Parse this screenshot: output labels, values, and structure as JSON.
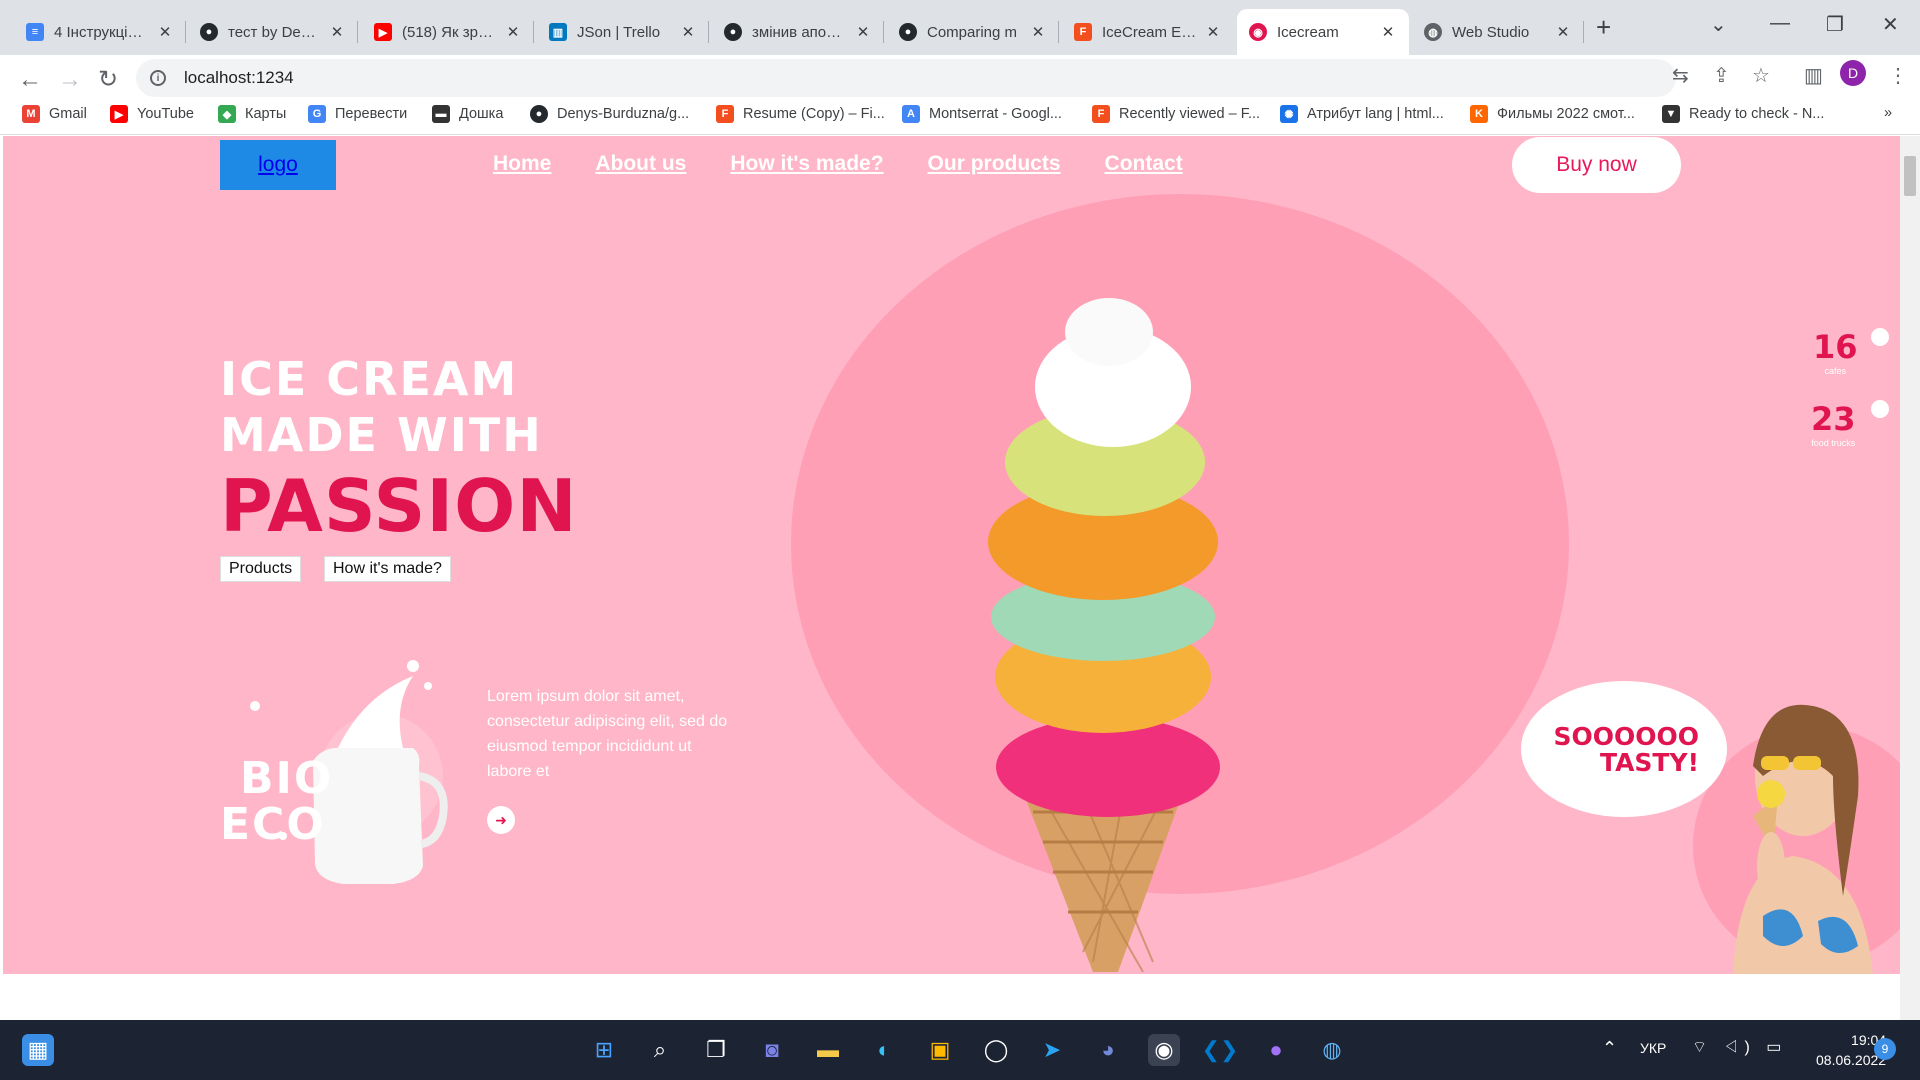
{
  "browser": {
    "tabs": [
      {
        "label": "4 Інструкція по",
        "icon": "docs-icon",
        "color": "#4285f4"
      },
      {
        "label": "тест by Denys",
        "icon": "github-icon",
        "color": "#24292e"
      },
      {
        "label": "(518) Як зробити",
        "icon": "youtube-icon",
        "color": "#ff0000"
      },
      {
        "label": "JSon | Trello",
        "icon": "trello-icon",
        "color": "#0079bf"
      },
      {
        "label": "змінив апостро",
        "icon": "github-icon",
        "color": "#24292e"
      },
      {
        "label": "Comparing m",
        "icon": "github-icon",
        "color": "#24292e"
      },
      {
        "label": "IceCream En (",
        "icon": "figma-icon",
        "color": "#f24e1e"
      },
      {
        "label": "Icecream",
        "icon": "icecream-icon",
        "color": "#e0154f"
      },
      {
        "label": "Web Studio",
        "icon": "globe-icon",
        "color": "#5f6368"
      }
    ],
    "url": "localhost:1234",
    "bookmarks": [
      {
        "label": "Gmail",
        "icon": "gmail-icon",
        "color": "#ea4335"
      },
      {
        "label": "YouTube",
        "icon": "youtube-icon",
        "color": "#ff0000"
      },
      {
        "label": "Карты",
        "icon": "maps-icon",
        "color": "#34a853"
      },
      {
        "label": "Перевести",
        "icon": "translate-icon",
        "color": "#4285f4"
      },
      {
        "label": "Дошка",
        "icon": "board-icon",
        "color": "#333333"
      },
      {
        "label": "Denys-Burduzna/g...",
        "icon": "github-icon",
        "color": "#24292e"
      },
      {
        "label": "Resume (Copy) – Fi...",
        "icon": "figma-icon",
        "color": "#f24e1e"
      },
      {
        "label": "Montserrat - Googl...",
        "icon": "fonts-icon",
        "color": "#4285f4"
      },
      {
        "label": "Recently viewed – F...",
        "icon": "figma-icon",
        "color": "#f24e1e"
      },
      {
        "label": "Атрибут lang | html...",
        "icon": "web-icon",
        "color": "#1a73e8"
      },
      {
        "label": "Фильмы 2022 смот...",
        "icon": "kino-icon",
        "color": "#ff6600"
      },
      {
        "label": "Ready to check - N...",
        "icon": "nexus-icon",
        "color": "#333333"
      }
    ]
  },
  "site": {
    "logo": "logo",
    "nav": [
      "Home",
      "About us",
      "How it's made?",
      "Our products",
      "Contact"
    ],
    "buy_now": "Buy now",
    "headline_line1": "ICE CREAM",
    "headline_line2": "MADE WITH",
    "headline_accent": "PASSION",
    "btn_products": "Products",
    "btn_how": "How it's made?",
    "lorem": "Lorem ipsum dolor sit amet, consectetur adipiscing elit, sed do eiusmod tempor incididunt ut labore et",
    "bio": "BIO",
    "eco": "ECO",
    "stats": [
      {
        "num": "16",
        "label": "cafes"
      },
      {
        "num": "23",
        "label": "food trucks"
      }
    ],
    "bubble_line1": "SOOOOOO",
    "bubble_line2": "TASTY!"
  },
  "taskbar": {
    "lang": "УКР",
    "time": "19:04",
    "date": "08.06.2022",
    "notifications": "9"
  }
}
